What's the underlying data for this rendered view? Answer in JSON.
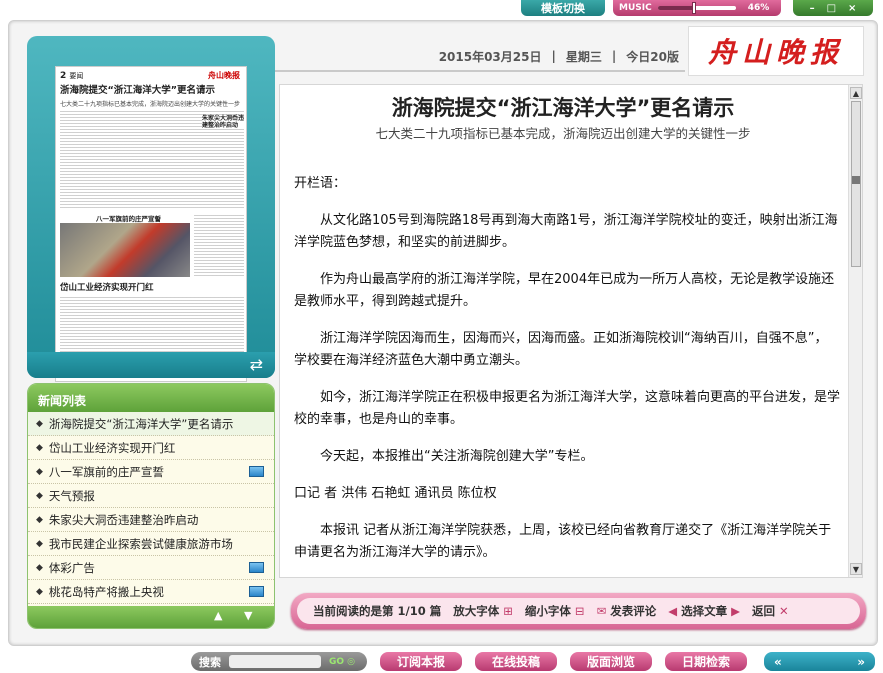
{
  "topbar": {
    "template_switch": "模板切换",
    "music_label": "MUSIC",
    "music_volume_text": "46%",
    "music_volume": 0.46,
    "window_controls": [
      "–",
      "□",
      "×"
    ]
  },
  "header": {
    "date": "2015年03月25日",
    "weekday": "星期三",
    "edition": "今日20版",
    "logo": "舟山晚报"
  },
  "thumbnail": {
    "page_number": "2",
    "section": "要闻",
    "brand": "舟山晚报",
    "headline": "浙海院提交“浙江海洋大学”更名请示",
    "subhead": "七大类二十九项指标已基本完成，浙海院迈出创建大学的关键性一步",
    "side_headline": "朱家尖大洞岙违建整治昨启动",
    "photo_caption": "八一军旗前的庄严宣誓",
    "headline2": "岱山工业经济实现开门红"
  },
  "news_list": {
    "title": "新闻列表",
    "items": [
      {
        "label": "浙海院提交“浙江海洋大学”更名请示",
        "has_media": false
      },
      {
        "label": "岱山工业经济实现开门红",
        "has_media": false
      },
      {
        "label": "八一军旗前的庄严宣誓",
        "has_media": true
      },
      {
        "label": "天气预报",
        "has_media": false
      },
      {
        "label": "朱家尖大洞岙违建整治昨启动",
        "has_media": false
      },
      {
        "label": "我市民建企业探索尝试健康旅游市场",
        "has_media": false
      },
      {
        "label": "体彩广告",
        "has_media": true
      },
      {
        "label": "桃花岛特产将搬上央视",
        "has_media": true
      }
    ]
  },
  "article": {
    "title": "浙海院提交“浙江海洋大学”更名请示",
    "subtitle": "七大类二十九项指标已基本完成，浙海院迈出创建大学的关键性一步",
    "paragraphs": [
      "开栏语：",
      "从文化路105号到海院路18号再到海大南路1号，浙江海洋学院校址的变迁，映射出浙江海洋学院蓝色梦想，和坚实的前进脚步。",
      "作为舟山最高学府的浙江海洋学院，早在2004年已成为一所万人高校，无论是教学设施还是教师水平，得到跨越式提升。",
      "浙江海洋学院因海而生，因海而兴，因海而盛。正如浙海院校训“海纳百川，自强不息”，学校要在海洋经济蓝色大潮中勇立潮头。",
      "如今，浙江海洋学院正在积极申报更名为浙江海洋大学，这意味着向更高的平台进发，是学校的幸事，也是舟山的幸事。",
      "今天起，本报推出“关注浙海院创建大学”专栏。",
      "口记 者 洪伟 石艳虹 通讯员 陈位权",
      "本报讯 记者从浙江海洋学院获悉，上周，该校已经向省教育厅递交了《浙江海洋学院关于申请更名为浙江海洋大学的请示》。"
    ]
  },
  "reader_bar": {
    "reading_prefix": "当前阅读的是第",
    "reading_index": "1/10",
    "reading_suffix": "篇",
    "zoom_in": "放大字体",
    "zoom_out": "缩小字体",
    "comment": "发表评论",
    "select_article": "选择文章",
    "back": "返回"
  },
  "bottom_bar": {
    "search_label": "搜索",
    "go_label": "GO",
    "subscribe": "订阅本报",
    "submit": "在线投稿",
    "browse": "版面浏览",
    "date_search": "日期检索",
    "nav_prev": "«",
    "nav_next": "»"
  }
}
